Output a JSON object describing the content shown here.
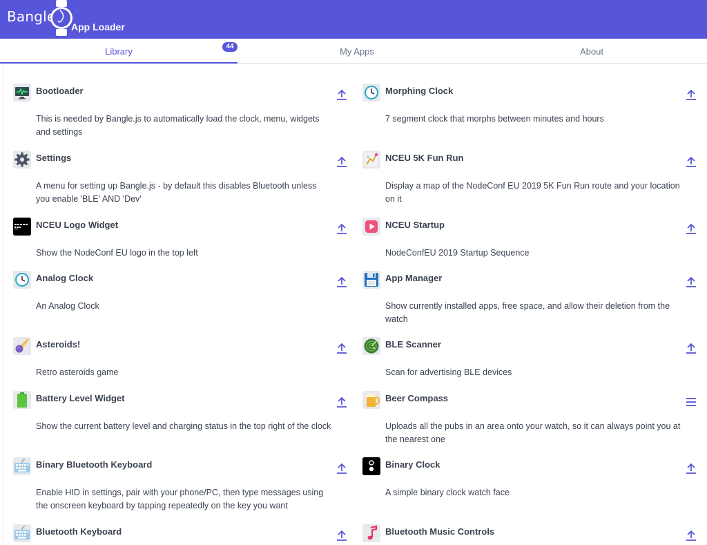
{
  "header": {
    "brand": "Bangle",
    "title": "App Loader"
  },
  "tabs": [
    {
      "label": "Library",
      "active": true
    },
    {
      "label": "My Apps"
    },
    {
      "label": "About"
    }
  ],
  "badge": {
    "count": "44"
  },
  "colors": {
    "accent": "#5755d9",
    "text": "#3b4351",
    "muted": "#66758c"
  },
  "apps": [
    {
      "name": "Bootloader",
      "desc": "This is needed by Bangle.js to automatically load the clock, menu, widgets and settings",
      "icon": "monitor-icon",
      "action": "upload-icon"
    },
    {
      "name": "Morphing Clock",
      "desc": "7 segment clock that morphs between minutes and hours",
      "icon": "clock-icon",
      "action": "upload-icon"
    },
    {
      "name": "Settings",
      "desc": "A menu for setting up Bangle.js - by default this disables Bluetooth unless you enable 'BLE' AND 'Dev'",
      "icon": "gear-icon",
      "action": "upload-icon"
    },
    {
      "name": "NCEU 5K Fun Run",
      "desc": "Display a map of the NodeConf EU 2019 5K Fun Run route and your location on it",
      "icon": "map-icon",
      "action": "upload-icon"
    },
    {
      "name": "NCEU Logo Widget",
      "desc": "Show the NodeConf EU logo in the top left",
      "icon": "nodeconf-logo-icon",
      "action": "upload-icon"
    },
    {
      "name": "NCEU Startup",
      "desc": "NodeConfEU 2019 Startup Sequence",
      "icon": "play-icon",
      "action": "upload-icon"
    },
    {
      "name": "Analog Clock",
      "desc": "An Analog Clock",
      "icon": "clock-icon",
      "action": "upload-icon"
    },
    {
      "name": "App Manager",
      "desc": "Show currently installed apps, free space, and allow their deletion from the watch",
      "icon": "floppy-disk-icon",
      "action": "upload-icon"
    },
    {
      "name": "Asteroids!",
      "desc": "Retro asteroids game",
      "icon": "asteroid-icon",
      "action": "upload-icon"
    },
    {
      "name": "BLE Scanner",
      "desc": "Scan for advertising BLE devices",
      "icon": "radar-icon",
      "action": "upload-icon"
    },
    {
      "name": "Battery Level Widget",
      "desc": "Show the current battery level and charging status in the top right of the clock",
      "icon": "battery-icon",
      "action": "upload-icon"
    },
    {
      "name": "Beer Compass",
      "desc": "Uploads all the pubs in an area onto your watch, so it can always point you at the nearest one",
      "icon": "beer-icon",
      "action": "menu-icon"
    },
    {
      "name": "Binary Bluetooth Keyboard",
      "desc": "Enable HID in settings, pair with your phone/PC, then type messages using the onscreen keyboard by tapping repeatedly on the key you want",
      "icon": "keyboard-icon",
      "action": "upload-icon"
    },
    {
      "name": "Binary Clock",
      "desc": "A simple binary clock watch face",
      "icon": "binary-clock-icon",
      "action": "upload-icon"
    },
    {
      "name": "Bluetooth Keyboard",
      "desc": "",
      "icon": "keyboard-icon",
      "action": "upload-icon"
    },
    {
      "name": "Bluetooth Music Controls",
      "desc": "",
      "icon": "music-note-icon",
      "action": "upload-icon"
    }
  ]
}
